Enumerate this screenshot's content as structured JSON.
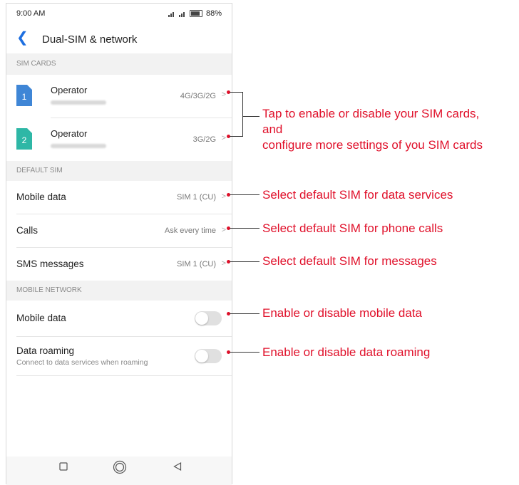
{
  "status_bar": {
    "time": "9:00 AM",
    "battery": "88%"
  },
  "header": {
    "title": "Dual-SIM & network"
  },
  "sections": {
    "sim_cards": "SIM CARDS",
    "default_sim": "DEFAULT SIM",
    "mobile_network": "MOBILE NETWORK"
  },
  "sim_cards": [
    {
      "number": "1",
      "name": "Operator",
      "network": "4G/3G/2G",
      "color": "#3f86d6"
    },
    {
      "number": "2",
      "name": "Operator",
      "network": "3G/2G",
      "color": "#2eb7a6"
    }
  ],
  "default_sim": [
    {
      "label": "Mobile data",
      "value": "SIM 1 (CU)"
    },
    {
      "label": "Calls",
      "value": "Ask every time"
    },
    {
      "label": "SMS messages",
      "value": "SIM 1 (CU)"
    }
  ],
  "mobile_network": [
    {
      "label": "Mobile data",
      "enabled": false
    },
    {
      "label": "Data roaming",
      "subtitle": "Connect to data services when roaming",
      "enabled": false
    }
  ],
  "annotations": {
    "sim_cards_1": "Tap to enable or disable your SIM cards,",
    "sim_cards_2": "and",
    "sim_cards_3": "configure more settings of you SIM cards",
    "mobile_data_default": "Select default SIM for data services",
    "calls_default": "Select default SIM for phone calls",
    "sms_default": "Select default SIM for messages",
    "mobile_data_toggle": "Enable or disable mobile data",
    "roaming_toggle": "Enable or disable data roaming"
  },
  "colors": {
    "accent": "#1e6fe0",
    "annotation": "#e0102a"
  }
}
